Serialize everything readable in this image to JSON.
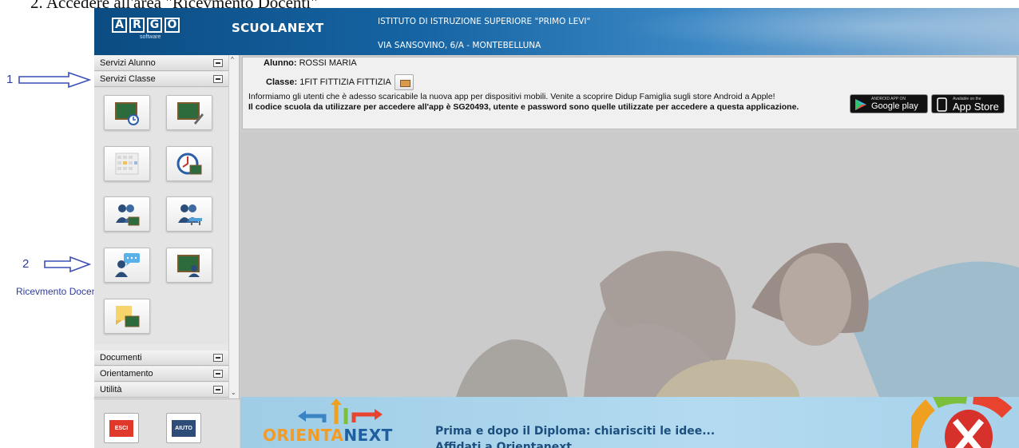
{
  "document": {
    "heading": "2.  Accedere all'area \"Ricevmento Docenti\""
  },
  "annotations": {
    "marker1": "1",
    "marker2": "2",
    "label": "Ricevmento Docenti"
  },
  "header": {
    "logo_letters": [
      "A",
      "R",
      "G",
      "O"
    ],
    "logo_sub": "software",
    "app_name": "SCUOLANEXT",
    "school_name": "ISTITUTO DI ISTRUZIONE SUPERIORE \"PRIMO LEVI\"",
    "school_address": "VIA SANSOVINO, 6/A - MONTEBELLUNA"
  },
  "sidebar": {
    "sections": {
      "servizi_alunno": "Servizi Alunno",
      "servizi_classe": "Servizi Classe",
      "documenti": "Documenti",
      "orientamento": "Orientamento",
      "utilita": "Utilità"
    },
    "tiles": [
      {
        "icon": "presence-board-icon"
      },
      {
        "icon": "board-edit-icon"
      },
      {
        "icon": "calendar-grid-icon"
      },
      {
        "icon": "clock-board-icon"
      },
      {
        "icon": "teachers-group-icon"
      },
      {
        "icon": "teachers-desk-icon"
      },
      {
        "icon": "ricevimento-docenti-icon"
      },
      {
        "icon": "board-teacher-icon"
      },
      {
        "icon": "notes-board-icon"
      }
    ],
    "bottom": {
      "exit_label": "ESCI",
      "help_label": "AIUTO",
      "exit_color": "#e0392b",
      "help_color": "#2f4c78"
    }
  },
  "main": {
    "student_label": "Alunno:",
    "student_name": "ROSSI MARIA",
    "class_label": "Classe:",
    "class_value": "1FIT FITTIZIA FITTIZIA",
    "notice_line1": "Informiamo gli utenti che è adesso scaricabile la nuova app per dispositivi mobili. Venite a scoprire Didup Famiglia sugli store Android a Apple!",
    "notice_line2": "Il codice scuola da utilizzare per accedere all'app è SG20493, utente e password sono quelle utilizzate per accedere a questa applicazione.",
    "google_small": "ANDROID APP ON",
    "google_big": "Google play",
    "apple_small": "Available on the",
    "apple_big": "App Store"
  },
  "banner": {
    "logo_part1": "ORIENTA",
    "logo_part2": "NEXT",
    "line1": "Prima e dopo il Diploma: chiarisciti le idee...",
    "line2": "Affidati a Orientanext."
  }
}
